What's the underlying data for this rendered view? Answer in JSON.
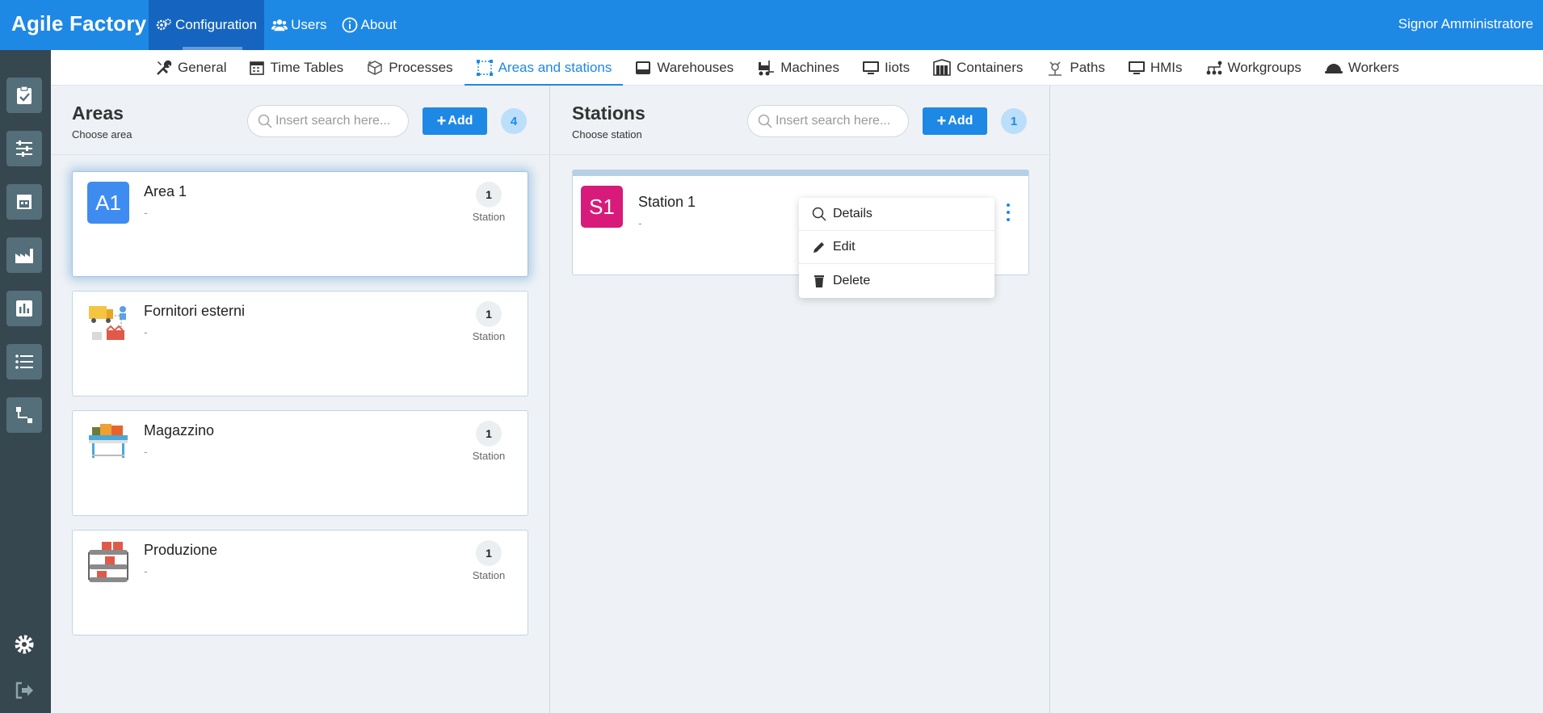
{
  "app": {
    "title": "Agile Factory",
    "user": "Signor Amministratore"
  },
  "topnav": {
    "configuration": "Configuration",
    "users": "Users",
    "about": "About"
  },
  "subnav": {
    "general": "General",
    "timetables": "Time Tables",
    "processes": "Processes",
    "areas": "Areas and stations",
    "warehouses": "Warehouses",
    "machines": "Machines",
    "iiots": "Iiots",
    "containers": "Containers",
    "paths": "Paths",
    "hmis": "HMIs",
    "workgroups": "Workgroups",
    "workers": "Workers"
  },
  "sidebar_icons": [
    "clipboard-check-icon",
    "sliders-icon",
    "warehouse-icon",
    "factory-icon",
    "bar-chart-icon",
    "list-icon",
    "flow-icon",
    "gear-icon",
    "logout-icon"
  ],
  "areas": {
    "title": "Areas",
    "subtitle": "Choose area",
    "search_placeholder": "Insert search here...",
    "add_label": "Add",
    "count": "4",
    "items": [
      {
        "avatar": "A1",
        "avatar_color": "#3f8cf0",
        "name": "Area 1",
        "desc": "-",
        "count": "1",
        "count_label": "Station"
      },
      {
        "name": "Fornitori esterni",
        "desc": "-",
        "count": "1",
        "count_label": "Station"
      },
      {
        "name": "Magazzino",
        "desc": "-",
        "count": "1",
        "count_label": "Station"
      },
      {
        "name": "Produzione",
        "desc": "-",
        "count": "1",
        "count_label": "Station"
      }
    ]
  },
  "stations": {
    "title": "Stations",
    "subtitle": "Choose station",
    "search_placeholder": "Insert search here...",
    "add_label": "Add",
    "count": "1",
    "items": [
      {
        "avatar": "S1",
        "avatar_color": "#d81b7a",
        "name": "Station 1",
        "desc": "-"
      }
    ],
    "menu": {
      "details": "Details",
      "edit": "Edit",
      "delete": "Delete"
    }
  },
  "colors": {
    "primary": "#1e88e5",
    "sidebar": "#37474f",
    "sidebar_button": "#546e7a"
  }
}
